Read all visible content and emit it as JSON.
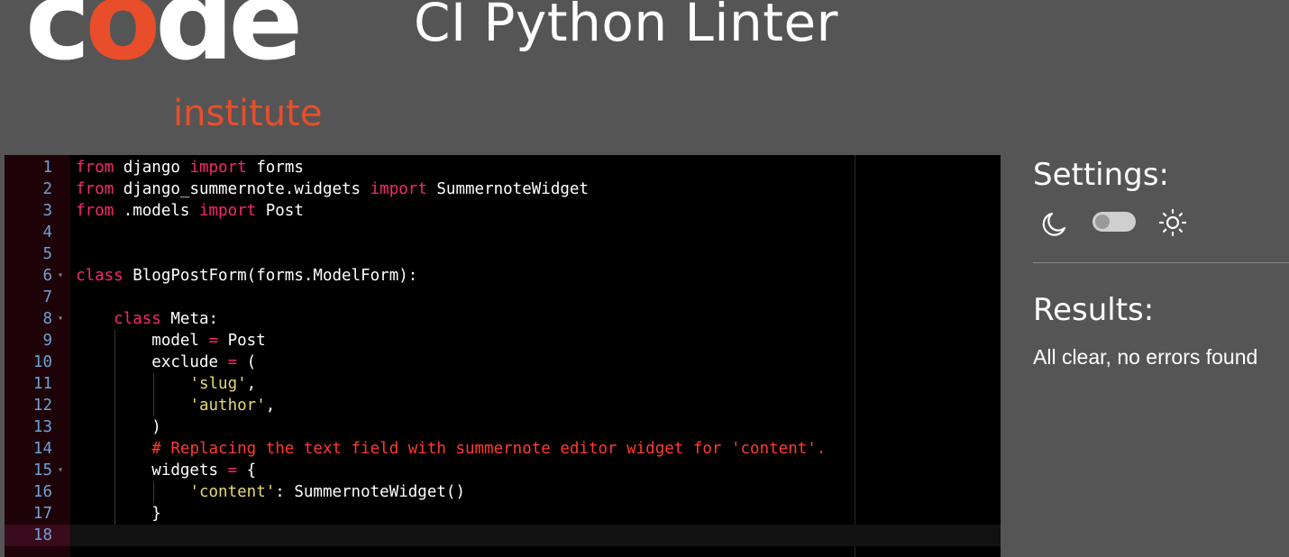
{
  "header": {
    "logo_word": "code",
    "logo_sub": "institute",
    "title": "CI Python Linter"
  },
  "editor": {
    "active_line": 18,
    "lines": [
      {
        "n": 1,
        "fold": false,
        "guides": 0,
        "tokens": [
          [
            "kw",
            "from"
          ],
          [
            "t",
            " django "
          ],
          [
            "kw",
            "import"
          ],
          [
            "t",
            " forms"
          ]
        ]
      },
      {
        "n": 2,
        "fold": false,
        "guides": 0,
        "tokens": [
          [
            "kw",
            "from"
          ],
          [
            "t",
            " django_summernote.widgets "
          ],
          [
            "kw",
            "import"
          ],
          [
            "t",
            " SummernoteWidget"
          ]
        ]
      },
      {
        "n": 3,
        "fold": false,
        "guides": 0,
        "tokens": [
          [
            "kw",
            "from"
          ],
          [
            "t",
            " .models "
          ],
          [
            "kw",
            "import"
          ],
          [
            "t",
            " Post"
          ]
        ]
      },
      {
        "n": 4,
        "fold": false,
        "guides": 0,
        "tokens": []
      },
      {
        "n": 5,
        "fold": false,
        "guides": 0,
        "tokens": []
      },
      {
        "n": 6,
        "fold": true,
        "guides": 0,
        "tokens": [
          [
            "kw",
            "class"
          ],
          [
            "t",
            " BlogPostForm(forms.ModelForm):"
          ]
        ]
      },
      {
        "n": 7,
        "fold": false,
        "guides": 0,
        "tokens": []
      },
      {
        "n": 8,
        "fold": true,
        "guides": 0,
        "tokens": [
          [
            "t",
            "    "
          ],
          [
            "kw",
            "class"
          ],
          [
            "t",
            " Meta:"
          ]
        ]
      },
      {
        "n": 9,
        "fold": false,
        "guides": 1,
        "tokens": [
          [
            "t",
            "        model "
          ],
          [
            "op",
            "="
          ],
          [
            "t",
            " Post"
          ]
        ]
      },
      {
        "n": 10,
        "fold": false,
        "guides": 1,
        "tokens": [
          [
            "t",
            "        exclude "
          ],
          [
            "op",
            "="
          ],
          [
            "t",
            " ("
          ]
        ]
      },
      {
        "n": 11,
        "fold": false,
        "guides": 2,
        "tokens": [
          [
            "t",
            "            "
          ],
          [
            "str",
            "'slug'"
          ],
          [
            "t",
            ","
          ]
        ]
      },
      {
        "n": 12,
        "fold": false,
        "guides": 2,
        "tokens": [
          [
            "t",
            "            "
          ],
          [
            "str",
            "'author'"
          ],
          [
            "t",
            ","
          ]
        ]
      },
      {
        "n": 13,
        "fold": false,
        "guides": 1,
        "tokens": [
          [
            "t",
            "        )"
          ]
        ]
      },
      {
        "n": 14,
        "fold": false,
        "guides": 1,
        "tokens": [
          [
            "t",
            "        "
          ],
          [
            "cmt",
            "# Replacing the text field with summernote editor widget for 'content'."
          ]
        ]
      },
      {
        "n": 15,
        "fold": true,
        "guides": 1,
        "tokens": [
          [
            "t",
            "        widgets "
          ],
          [
            "op",
            "="
          ],
          [
            "t",
            " {"
          ]
        ]
      },
      {
        "n": 16,
        "fold": false,
        "guides": 2,
        "tokens": [
          [
            "t",
            "            "
          ],
          [
            "str",
            "'content'"
          ],
          [
            "t",
            ": SummernoteWidget()"
          ]
        ]
      },
      {
        "n": 17,
        "fold": false,
        "guides": 1,
        "tokens": [
          [
            "t",
            "        }"
          ]
        ]
      },
      {
        "n": 18,
        "fold": false,
        "guides": 0,
        "tokens": []
      }
    ]
  },
  "settings": {
    "title": "Settings:",
    "dark_icon": "moon-icon",
    "light_icon": "sun-icon",
    "theme_toggle_on": false
  },
  "results": {
    "title": "Results:",
    "message": "All clear, no errors found"
  },
  "colors": {
    "background": "#555555",
    "brand_orange": "#e84e2a",
    "keyword": "#f92672",
    "string": "#e6db74",
    "comment": "#ff3b30",
    "line_number": "#6fa0d6"
  }
}
